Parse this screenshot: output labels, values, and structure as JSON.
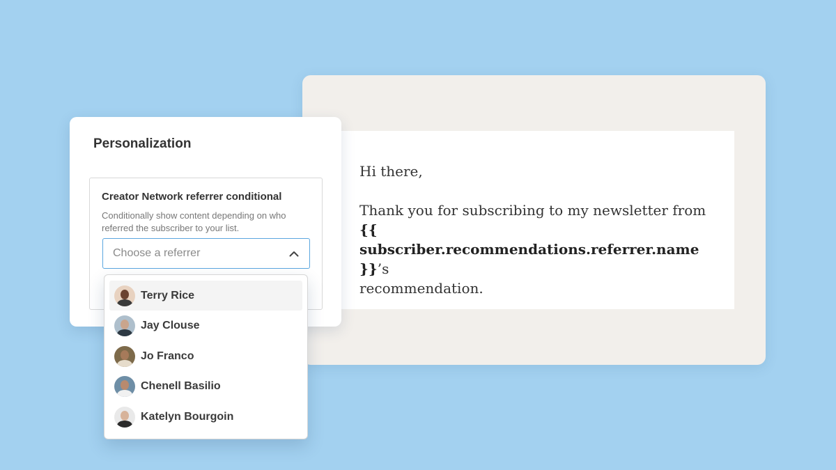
{
  "email": {
    "greeting": "Hi there,",
    "body_prefix": "Thank you for subscribing to my newsletter from",
    "merge_tag": "{{ subscriber.recommendations.referrer.name }}",
    "body_suffix": "’s",
    "body_end": "recommendation."
  },
  "personalization": {
    "title": "Personalization",
    "conditional": {
      "title": "Creator Network referrer conditional",
      "description": "Conditionally show content depending on who referred the subscriber to your list.",
      "select_placeholder": "Choose a referrer"
    }
  },
  "dropdown": {
    "options": [
      {
        "label": "Terry Rice",
        "avatar_icon": "avatar-terry-rice",
        "highlighted": true
      },
      {
        "label": "Jay Clouse",
        "avatar_icon": "avatar-jay-clouse",
        "highlighted": false
      },
      {
        "label": "Jo Franco",
        "avatar_icon": "avatar-jo-franco",
        "highlighted": false
      },
      {
        "label": "Chenell Basilio",
        "avatar_icon": "avatar-chenell-basilio",
        "highlighted": false
      },
      {
        "label": "Katelyn Bourgoin",
        "avatar_icon": "avatar-katelyn-bourgoin",
        "highlighted": false
      }
    ]
  },
  "colors": {
    "background": "#a3d1f0",
    "email_card": "#f2efeb",
    "select_border": "#5aa6df"
  }
}
